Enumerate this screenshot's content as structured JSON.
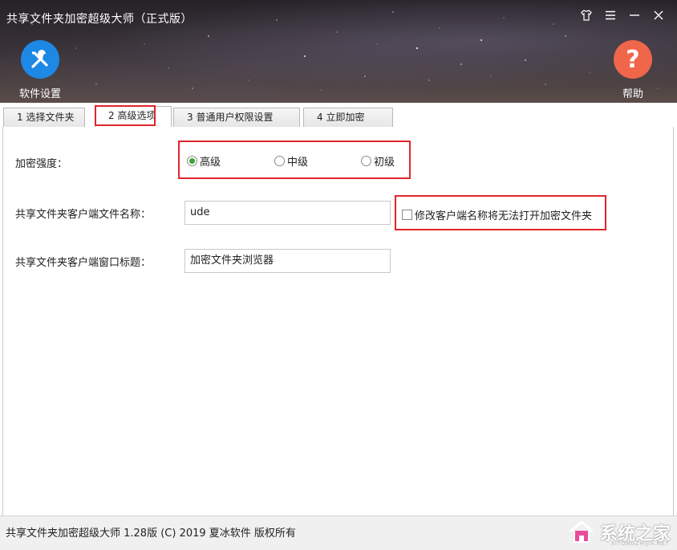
{
  "window": {
    "title": "共享文件夹加密超级大师（正式版）",
    "controls": [
      "skin-icon",
      "menu-icon",
      "minimize-icon",
      "close-icon"
    ]
  },
  "toolbar": {
    "settings_label": "软件设置",
    "help_label": "帮助",
    "help_glyph": "?",
    "settings_color": "#1e88e5",
    "help_color": "#f0664a"
  },
  "tabs": [
    {
      "label": "1 选择文件夹",
      "active": false
    },
    {
      "label": "2 高级选项",
      "active": true
    },
    {
      "label": "3 普通用户权限设置",
      "active": false
    },
    {
      "label": "4 立即加密",
      "active": false
    }
  ],
  "advanced": {
    "strength_label": "加密强度：",
    "strength_options": [
      {
        "label": "高级",
        "selected": true
      },
      {
        "label": "中级",
        "selected": false
      },
      {
        "label": "初级",
        "selected": false
      }
    ],
    "client_filename_label": "共享文件夹客户端文件名称：",
    "client_filename_value": "ude",
    "rename_warning_label": "修改客户端名称将无法打开加密文件夹",
    "rename_warning_checked": false,
    "window_title_label": "共享文件夹客户端窗口标题：",
    "window_title_value": "加密文件夹浏览器"
  },
  "statusbar": {
    "text": "共享文件夹加密超级大师 1.28版 (C) 2019 夏冰软件 版权所有"
  },
  "watermark": {
    "text": "系统之家",
    "sub": "XITONGZHIJIA.NET"
  },
  "colors": {
    "highlight_red": "#e0252b",
    "radio_selected": "#3aa43a"
  }
}
